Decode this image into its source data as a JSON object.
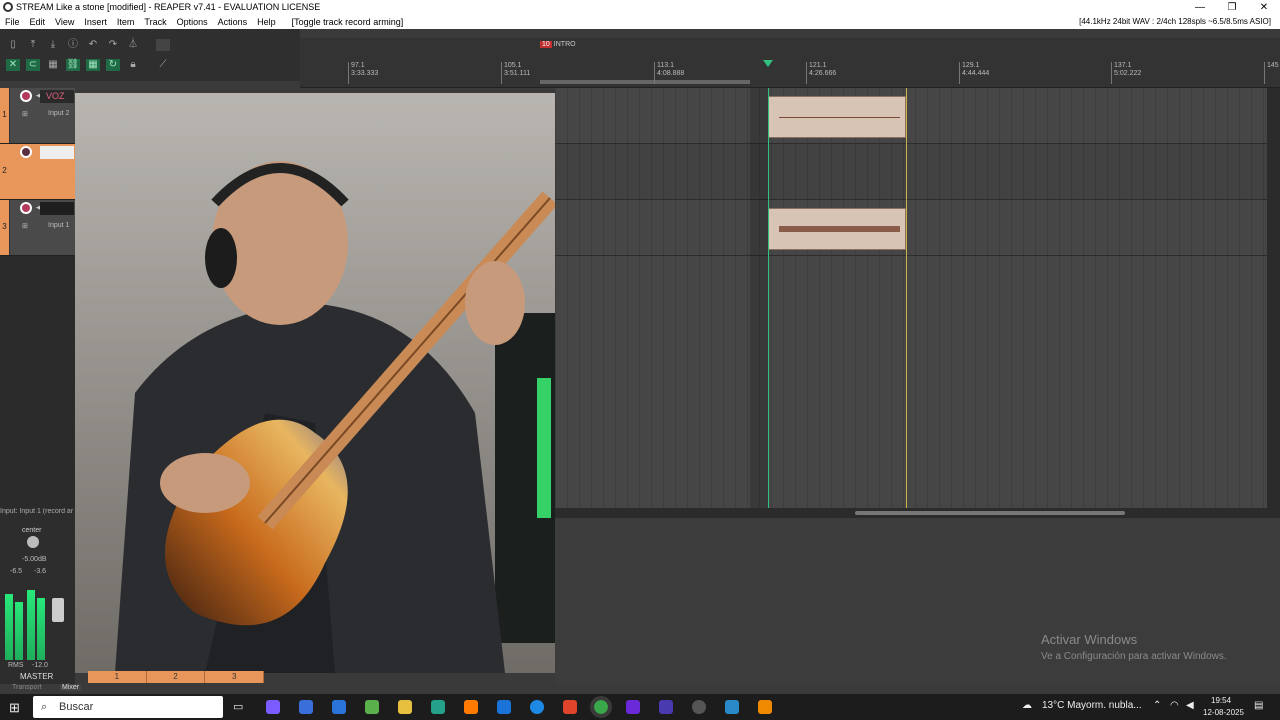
{
  "window": {
    "title": "STREAM Like a stone [modified] - REAPER v7.41 - EVALUATION LICENSE",
    "buttons": [
      "—",
      "❐",
      "✕"
    ]
  },
  "menu": {
    "items": [
      "File",
      "Edit",
      "View",
      "Insert",
      "Item",
      "Track",
      "Options",
      "Actions",
      "Help"
    ],
    "action": "[Toggle track record arming]",
    "audio_status": "[44.1kHz 24bit WAV : 2/4ch 128spls ~6.5/8.5ms ASIO]"
  },
  "ruler": {
    "region_number": "10",
    "region_name": "INTRO",
    "ticks": [
      {
        "bar": "97.1",
        "time": "3:33.333"
      },
      {
        "bar": "105.1",
        "time": "3:51.111"
      },
      {
        "bar": "113.1",
        "time": "4:08.888"
      },
      {
        "bar": "121.1",
        "time": "4:26.666"
      },
      {
        "bar": "129.1",
        "time": "4:44.444"
      },
      {
        "bar": "137.1",
        "time": "5:02.222"
      },
      {
        "bar": "145",
        "time": ""
      }
    ]
  },
  "tracks": [
    {
      "number": "1",
      "name": "VOZ",
      "input": "Input 2"
    },
    {
      "number": "2",
      "name": "",
      "input": ""
    },
    {
      "number": "3",
      "name": "",
      "input": "Input 1"
    }
  ],
  "status": {
    "input_line": "Input: Input 1 (record ar"
  },
  "mixer": {
    "pan": "center",
    "volume": "-5.00dB",
    "peak_left": "-6.5",
    "peak_right": "-3.6",
    "rms_label": "RMS",
    "rms_value": "-12.0",
    "master": "MASTER",
    "transport_tab": "Transport",
    "mixer_tab": "Mixer"
  },
  "timeline_tabs": [
    "1",
    "2",
    "3"
  ],
  "watermark": {
    "line1": "Activar Windows",
    "line2": "Ve a Configuración para activar Windows."
  },
  "taskbar": {
    "search": "Buscar",
    "weather": "13°C  Mayorm. nubla...",
    "time": "19:54",
    "date": "12-08-2025"
  },
  "colors": {
    "track_accent": "#e8965a",
    "record": "#b33a5a",
    "meter": "#28e87a",
    "edit_cursor": "#2ec27e",
    "play_cursor": "#c9b44a"
  }
}
